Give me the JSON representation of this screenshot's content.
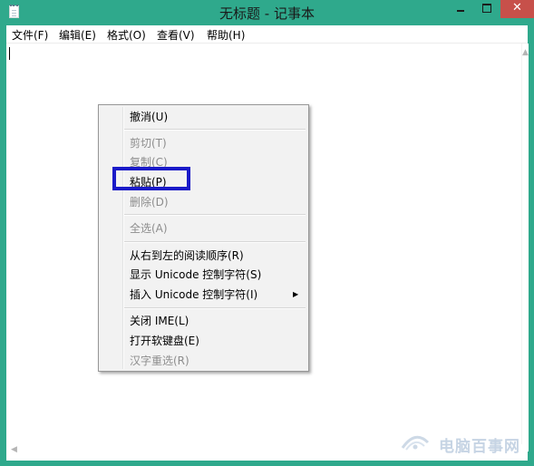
{
  "window": {
    "title": "无标题 - 记事本",
    "close_glyph": "✕"
  },
  "menubar": {
    "items": [
      {
        "label": "文件(F)"
      },
      {
        "label": "编辑(E)"
      },
      {
        "label": "格式(O)"
      },
      {
        "label": "查看(V)"
      },
      {
        "label": "帮助(H)"
      }
    ]
  },
  "editor": {
    "content": ""
  },
  "context_menu": {
    "items": [
      {
        "label": "撤消(U)",
        "enabled": true
      },
      {
        "label": "剪切(T)",
        "enabled": false
      },
      {
        "label": "复制(C)",
        "enabled": false
      },
      {
        "label": "粘贴(P)",
        "enabled": true,
        "highlighted": true
      },
      {
        "label": "删除(D)",
        "enabled": false
      },
      {
        "label": "全选(A)",
        "enabled": false
      },
      {
        "label": "从右到左的阅读顺序(R)",
        "enabled": true
      },
      {
        "label": "显示 Unicode 控制字符(S)",
        "enabled": true
      },
      {
        "label": "插入 Unicode 控制字符(I)",
        "enabled": true,
        "has_submenu": true
      },
      {
        "label": "关闭 IME(L)",
        "enabled": true
      },
      {
        "label": "打开软键盘(E)",
        "enabled": true
      },
      {
        "label": "汉字重选(R)",
        "enabled": false
      }
    ],
    "submenu_glyph": "▶",
    "highlight_color": "#1a1ac8"
  },
  "scrollbars": {
    "up_glyph": "▲",
    "left_glyph": "◀"
  },
  "watermark": {
    "text": "电脑百事网"
  },
  "colors": {
    "titlebar": "#2fa98c",
    "close_button": "#c7504a",
    "menu_background": "#f2f2f2",
    "disabled_text": "#8d8d8d"
  },
  "icons": {
    "app": "notepad-icon",
    "minimize": "minimize-icon",
    "maximize": "maximize-icon",
    "close": "close-icon",
    "submenu": "chevron-right-icon",
    "scroll_up": "arrow-up-icon",
    "scroll_left": "arrow-left-icon"
  }
}
